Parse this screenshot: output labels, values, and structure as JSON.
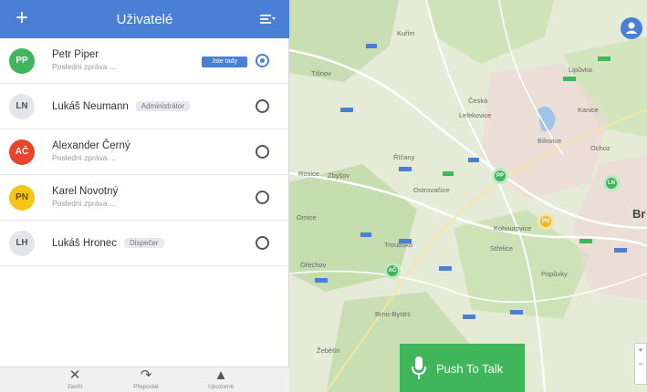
{
  "header": {
    "title": "Uživatelé",
    "add_icon": "plus-icon",
    "filter_icon": "filter-icon"
  },
  "users": [
    {
      "initials": "PP",
      "name": "Petr Piper",
      "sub": "Posledni zpráva ...",
      "tag": "",
      "badge": "Jste tady",
      "selected": true,
      "color": "#3fb65a",
      "text_color": "#ffffff"
    },
    {
      "initials": "LN",
      "name": "Lukáš Neumann",
      "sub": "",
      "tag": "Administrátor",
      "badge": "",
      "selected": false,
      "color": "#e3e5e8",
      "text_color": "#555555"
    },
    {
      "initials": "AČ",
      "name": "Alexander Černý",
      "sub": "Posledni zpráva ...",
      "tag": "",
      "badge": "",
      "selected": false,
      "color": "#e8442e",
      "text_color": "#ffffff"
    },
    {
      "initials": "PN",
      "name": "Karel Novotný",
      "sub": "Posledni zpráva ...",
      "tag": "",
      "badge": "",
      "selected": false,
      "color": "#f5c518",
      "text_color": "#6b4c00"
    },
    {
      "initials": "LH",
      "name": "Lukáš Hronec",
      "sub": "",
      "tag": "Dispečer",
      "badge": "",
      "selected": false,
      "color": "#e3e5e8",
      "text_color": "#555555"
    }
  ],
  "toolbar": {
    "close_label": "Zavřít",
    "forward_label": "Přeposlat",
    "alert_label": "Upozornit"
  },
  "map": {
    "city": "Br",
    "places": [
      "Kuřim",
      "Lipůvka",
      "Tišnov",
      "Česká",
      "Lelekovice",
      "Kanice",
      "Bílovice",
      "Ochoz",
      "Říčany",
      "Rosice",
      "Zbýšov",
      "Ostrovačice",
      "Omice",
      "Troubsko",
      "Střelice",
      "Popůvky",
      "Ořechov",
      "Brno-Bystrc",
      "Kohoutovice",
      "Žebětín"
    ],
    "markers": [
      {
        "label": "PP",
        "kind": "green"
      },
      {
        "label": "LN",
        "kind": "green"
      },
      {
        "label": "AČ",
        "kind": "green"
      },
      {
        "label": "PN",
        "kind": "yellow"
      }
    ],
    "zoom_in": "+",
    "zoom_out": "−",
    "user_icon": "user-circle-icon"
  },
  "ptt": {
    "label": "Push To Talk",
    "icon": "microphone-icon"
  },
  "colors": {
    "primary": "#4a7fd6",
    "ptt": "#3fb65a",
    "map_bg": "#e4ead5"
  }
}
